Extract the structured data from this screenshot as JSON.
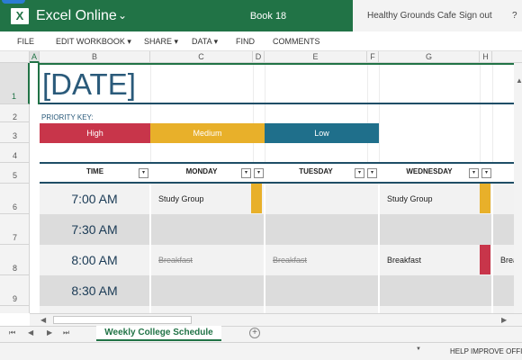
{
  "app": {
    "title": "Excel Online",
    "chevron": "⌄",
    "logo_letter": "X",
    "book_name": "Book 18",
    "account": "Healthy Grounds Cafe",
    "sign_out": "Sign out",
    "help": "?"
  },
  "ribbon": {
    "items": [
      "FILE",
      "EDIT WORKBOOK ▾",
      "SHARE ▾",
      "DATA ▾",
      "FIND",
      "COMMENTS"
    ]
  },
  "grid": {
    "columns": [
      "A",
      "B",
      "C",
      "D",
      "E",
      "F",
      "G",
      "H"
    ],
    "rows": [
      "1",
      "2",
      "3",
      "4",
      "5",
      "6",
      "7",
      "8",
      "9"
    ]
  },
  "sheet": {
    "date_placeholder": "[DATE]",
    "priority_label": "PRIORITY KEY:",
    "priorities": {
      "high": "High",
      "medium": "Medium",
      "low": "Low"
    },
    "headers": {
      "time": "TIME",
      "monday": "MONDAY",
      "tuesday": "TUESDAY",
      "wednesday": "WEDNESDAY"
    },
    "times": [
      "7:00 AM",
      "7:30 AM",
      "8:00 AM",
      "8:30 AM"
    ],
    "events": {
      "mon_700": "Study Group",
      "wed_700": "Study Group",
      "mon_800": "Breakfast",
      "tue_800": "Breakfast",
      "wed_800": "Breakfast",
      "next_800": "Brea"
    }
  },
  "tabs": {
    "active": "Weekly College Schedule",
    "add": "+"
  },
  "status": {
    "caret": "▼",
    "help_improve": "HELP IMPROVE OFFICE"
  },
  "colors": {
    "excel_green": "#217346",
    "high": "#c8354a",
    "medium": "#e8b02a",
    "low": "#1f6f8b",
    "navy": "#1f4e66"
  }
}
